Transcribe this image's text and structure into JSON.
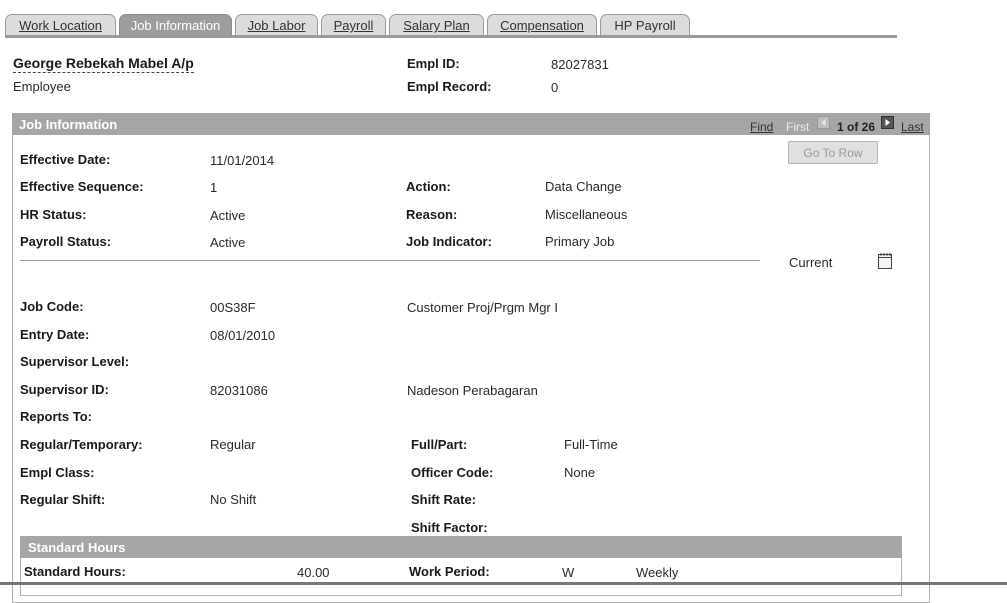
{
  "tabs": [
    {
      "label": "Work Location",
      "active": false
    },
    {
      "label": "Job Information",
      "active": true
    },
    {
      "label": "Job Labor",
      "active": false
    },
    {
      "label": "Payroll",
      "active": false
    },
    {
      "label": "Salary Plan",
      "active": false
    },
    {
      "label": "Compensation",
      "active": false
    },
    {
      "label": "HP Payroll",
      "active": false
    }
  ],
  "header": {
    "name": "George Rebekah Mabel A/p",
    "role": "Employee",
    "empl_id_label": "Empl ID:",
    "empl_id": "82027831",
    "empl_record_label": "Empl Record:",
    "empl_record": "0"
  },
  "job_info": {
    "title": "Job Information",
    "nav": {
      "find": "Find",
      "first": "First",
      "counter": "1 of 26",
      "last": "Last",
      "prev_icon": "left-arrow-icon",
      "next_icon": "right-arrow-icon"
    },
    "go_to_row": "Go To Row",
    "current_label": "Current",
    "calendar_icon": "notepad-icon",
    "fields": {
      "effective_date_label": "Effective Date:",
      "effective_date": "11/01/2014",
      "effective_sequence_label": "Effective Sequence:",
      "effective_sequence": "1",
      "action_label": "Action:",
      "action": "Data Change",
      "hr_status_label": "HR Status:",
      "hr_status": "Active",
      "reason_label": "Reason:",
      "reason": "Miscellaneous",
      "payroll_status_label": "Payroll Status:",
      "payroll_status": "Active",
      "job_indicator_label": "Job Indicator:",
      "job_indicator": "Primary Job",
      "job_code_label": "Job Code:",
      "job_code": "00S38F",
      "job_code_desc": "Customer Proj/Prgm Mgr I",
      "entry_date_label": "Entry Date:",
      "entry_date": "08/01/2010",
      "supervisor_level_label": "Supervisor Level:",
      "supervisor_id_label": "Supervisor ID:",
      "supervisor_id": "82031086",
      "supervisor_name": "Nadeson Perabagaran",
      "reports_to_label": "Reports To:",
      "regular_temporary_label": "Regular/Temporary:",
      "regular_temporary": "Regular",
      "full_part_label": "Full/Part:",
      "full_part": "Full-Time",
      "empl_class_label": "Empl Class:",
      "officer_code_label": "Officer Code:",
      "officer_code": "None",
      "regular_shift_label": "Regular Shift:",
      "regular_shift": "No Shift",
      "shift_rate_label": "Shift Rate:",
      "shift_factor_label": "Shift Factor:"
    }
  },
  "standard_hours": {
    "title": "Standard Hours",
    "standard_hours_label": "Standard Hours:",
    "standard_hours": "40.00",
    "work_period_label": "Work Period:",
    "work_period_code": "W",
    "work_period_desc": "Weekly"
  }
}
